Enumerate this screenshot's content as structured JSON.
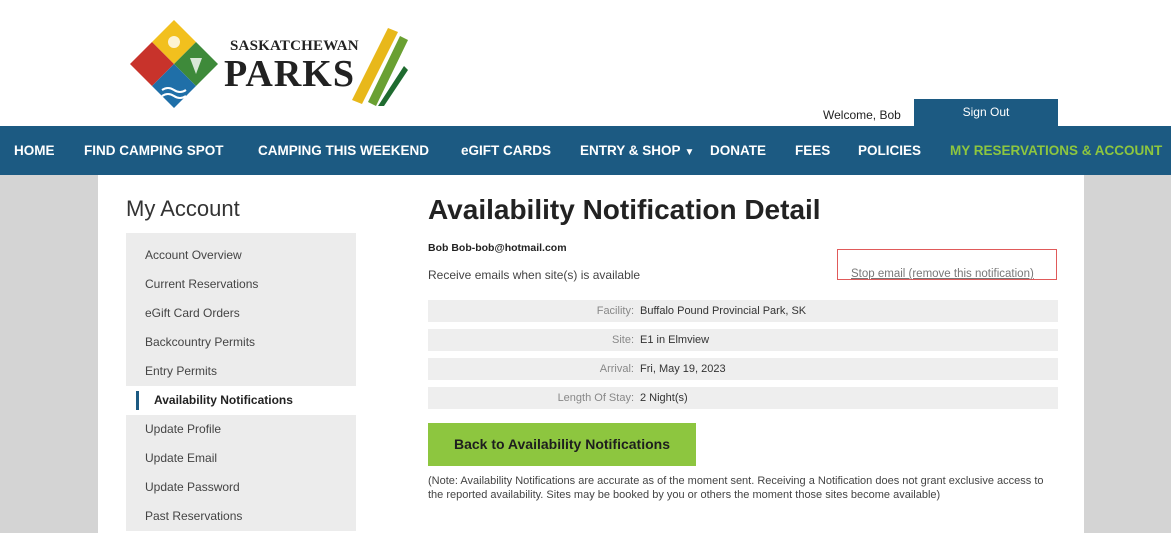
{
  "header": {
    "logo_top": "SASKATCHEWAN",
    "logo_main": "PARKS",
    "welcome": "Welcome, Bob",
    "sign_out": "Sign Out"
  },
  "nav": {
    "items": [
      {
        "label": "HOME"
      },
      {
        "label": "FIND CAMPING SPOT"
      },
      {
        "label": "CAMPING THIS WEEKEND"
      },
      {
        "label": "eGIFT CARDS"
      },
      {
        "label": "ENTRY & SHOP"
      },
      {
        "label": "DONATE"
      },
      {
        "label": "FEES"
      },
      {
        "label": "POLICIES"
      },
      {
        "label": "MY RESERVATIONS & ACCOUNT"
      }
    ],
    "active_color": "#8dc63f",
    "bar_color": "#1c5a82"
  },
  "sidebar": {
    "title": "My Account",
    "items": [
      {
        "label": "Account Overview"
      },
      {
        "label": "Current Reservations"
      },
      {
        "label": "eGift Card Orders"
      },
      {
        "label": "Backcountry Permits"
      },
      {
        "label": "Entry Permits"
      },
      {
        "label": "Availability Notifications"
      },
      {
        "label": "Update Profile"
      },
      {
        "label": "Update Email"
      },
      {
        "label": "Update Password"
      },
      {
        "label": "Past Reservations"
      }
    ]
  },
  "main": {
    "title": "Availability Notification Detail",
    "user_line": "Bob Bob-bob@hotmail.com",
    "subtitle": "Receive emails when site(s) is available",
    "stop_link": "Stop email (remove this notification)",
    "details": [
      {
        "label": "Facility:",
        "value": "Buffalo Pound Provincial Park, SK"
      },
      {
        "label": "Site:",
        "value": "E1 in Elmview"
      },
      {
        "label": "Arrival:",
        "value": "Fri, May 19, 2023"
      },
      {
        "label": "Length Of Stay:",
        "value": "2 Night(s)"
      }
    ],
    "back_button": "Back to Availability Notifications",
    "note": "(Note: Availability Notifications are accurate as of the moment sent. Receiving a Notification does not grant exclusive access to the reported availability. Sites may be booked by you or others the moment those sites become available)"
  }
}
